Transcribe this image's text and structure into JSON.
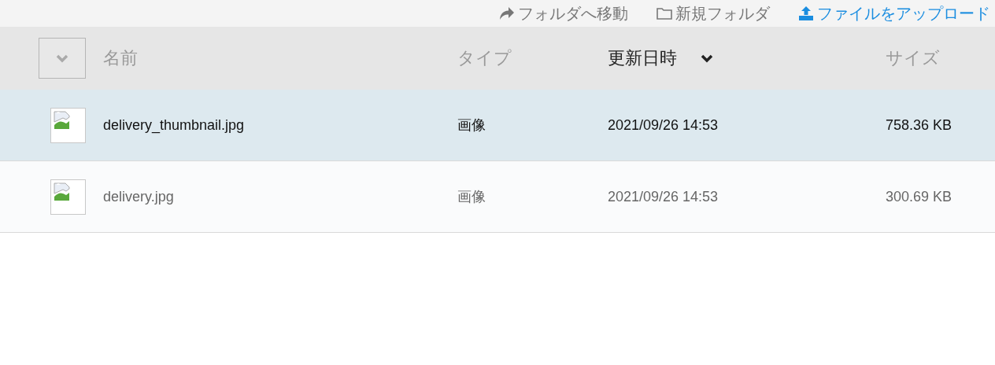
{
  "toolbar": [
    {
      "kind": "move",
      "label": "フォルダへ移動"
    },
    {
      "kind": "folder",
      "label": "新規フォルダ"
    },
    {
      "kind": "upload",
      "label": "ファイルをアップロード"
    }
  ],
  "table": {
    "columns": [
      {
        "label": "名前",
        "sorted": false
      },
      {
        "label": "タイプ",
        "sorted": false
      },
      {
        "label": "更新日時",
        "sorted": true
      },
      {
        "label": "サイズ",
        "sorted": false
      }
    ],
    "rows": [
      {
        "name": "delivery_thumbnail.jpg",
        "type": "画像",
        "modified": "2021/09/26 14:53",
        "size": "758.36 KB",
        "selected": true
      },
      {
        "name": "delivery.jpg",
        "type": "画像",
        "modified": "2021/09/26 14:53",
        "size": "300.69 KB",
        "selected": false
      }
    ]
  }
}
